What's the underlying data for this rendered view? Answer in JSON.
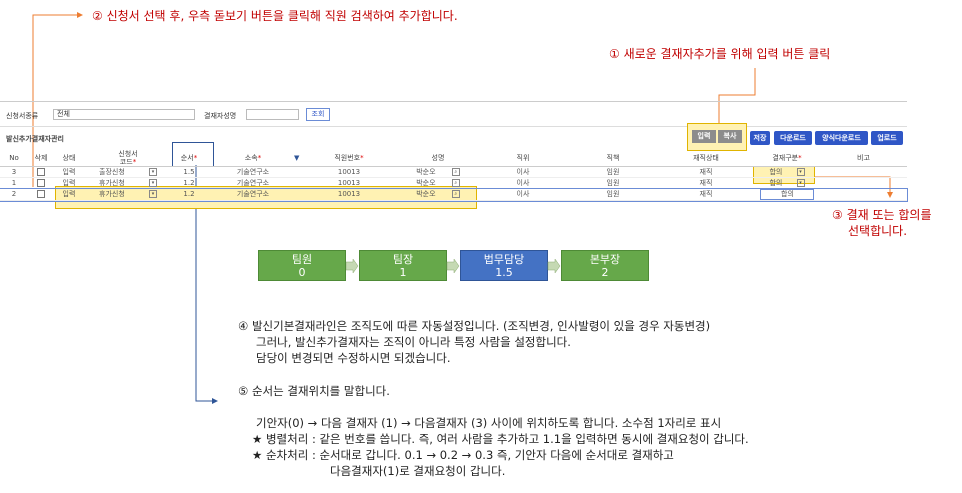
{
  "annotations": {
    "step1": "① 새로운 결재자추가를 위해 입력 버튼 클릭",
    "step2": "② 신청서 선택 후, 우측 돋보기 버튼을 클릭해 직원 검색하여 추가합니다.",
    "step3_line1": "③ 결재 또는 합의를",
    "step3_line2": "선택합니다.",
    "step4_lines": [
      "④ 발신기본결재라인은 조직도에 따른 자동설정입니다. (조직변경, 인사발령이 있을 경우 자동변경)",
      "그러나, 발신추가결재자는 조직이 아니라 특정 사람을 설정합니다.",
      "담당이 변경되면 수정하시면 되겠습니다."
    ],
    "step5_title": "⑤ 순서는 결재위치를 말합니다.",
    "step5_lines": [
      "기안자(0) → 다음 결재자 (1) → 다음결재자 (3) 사이에 위치하도록 합니다. 소수점 1자리로 표시",
      "★ 병렬처리 : 같은 번호를 씁니다. 즉, 여러 사람을 추가하고 1.1을 입력하면 동시에 결재요청이 갑니다.",
      "★ 순차처리 : 순서대로 갑니다. 0.1 → 0.2 → 0.3  즉, 기안자 다음에 순서대로 결재하고",
      "다음결재자(1)로 결재요청이 갑니다."
    ]
  },
  "search_bar": {
    "doc_type_label": "신청서종류",
    "doc_type_value": "전체",
    "approver_label": "결재자성명",
    "approver_value": "",
    "search_button": "조회"
  },
  "section": {
    "title": "발신추가결재자관리",
    "buttons": {
      "input": "입력",
      "copy": "복사",
      "save": "저장",
      "download": "다운로드",
      "form_download": "양식다운로드",
      "upload": "업로드"
    }
  },
  "grid": {
    "headers": {
      "no": "No",
      "delete": "삭제",
      "status": "상태",
      "form_code_line1": "신청서",
      "form_code_line2": "코드",
      "order": "순서",
      "dept": "소속",
      "emp_no": "직원번호",
      "name": "성명",
      "position": "직위",
      "title": "직책",
      "employment": "재직상태",
      "approval_type": "결재구분",
      "note": "비고"
    },
    "rows": [
      {
        "no": "3",
        "status": "입력",
        "form": "출장신청",
        "order": "1.5",
        "dept": "기술연구소",
        "emp_no": "10013",
        "name": "박순오",
        "position": "이사",
        "title": "임원",
        "employment": "재직",
        "approval_type": "합의"
      },
      {
        "no": "1",
        "status": "입력",
        "form": "휴가신청",
        "order": "1.2",
        "dept": "기술연구소",
        "emp_no": "10013",
        "name": "박순오",
        "position": "이사",
        "title": "임원",
        "employment": "재직",
        "approval_type": "합의"
      },
      {
        "no": "2",
        "status": "입력",
        "form": "휴가신청",
        "order": "1.2",
        "dept": "기술연구소",
        "emp_no": "10013",
        "name": "박순오",
        "position": "이사",
        "title": "임원",
        "employment": "재직",
        "approval_type": "합의"
      }
    ]
  },
  "org_chart": [
    {
      "role": "팀원",
      "order": "0"
    },
    {
      "role": "팀장",
      "order": "1"
    },
    {
      "role": "법무담당",
      "order": "1.5"
    },
    {
      "role": "본부장",
      "order": "2"
    }
  ],
  "colors": {
    "annotation_red": "#c00000",
    "arrow_orange": "#ed7d31",
    "highlight_yellow": "#fff2b3",
    "button_blue": "#2f56c6",
    "org_green": "#66a84a",
    "org_blue": "#4472c4"
  }
}
